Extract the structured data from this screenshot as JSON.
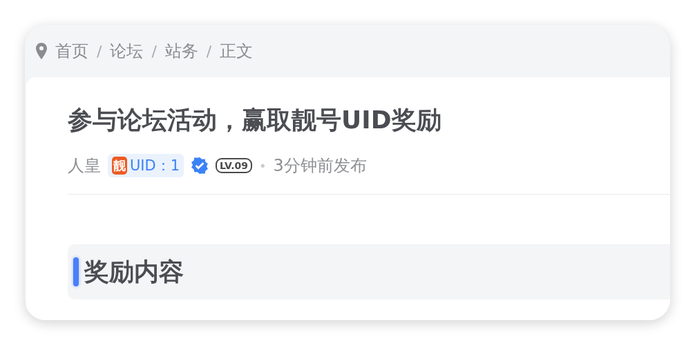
{
  "breadcrumb": [
    {
      "label": "首页"
    },
    {
      "label": "论坛"
    },
    {
      "label": "站务"
    },
    {
      "label": "正文"
    }
  ],
  "separator": "/",
  "post": {
    "title": "参与论坛活动，赢取靓号UID奖励",
    "author": "人皇",
    "uid_badge": {
      "mark": "靓",
      "text": "UID：1"
    },
    "verified": true,
    "level": "LV.09",
    "dot": "•",
    "time": "3分钟前发布"
  },
  "section": {
    "heading": "奖励内容"
  }
}
